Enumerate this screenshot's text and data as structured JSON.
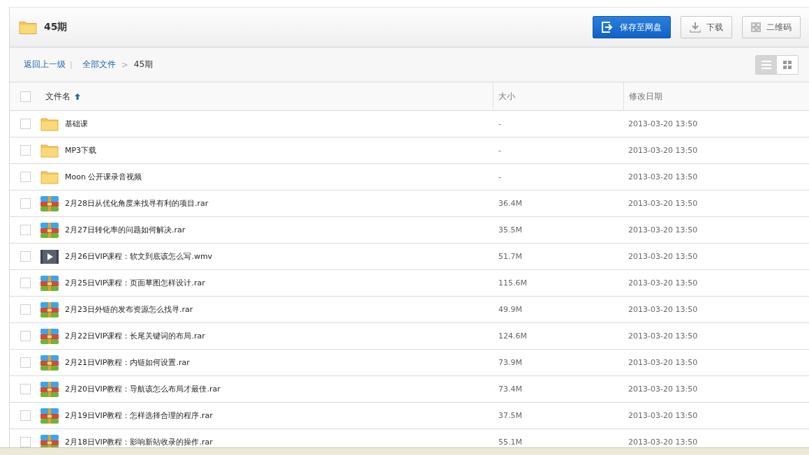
{
  "folder": {
    "title": "45期"
  },
  "actions": [
    {
      "kind": "save",
      "label": "保存至网盘"
    },
    {
      "kind": "download",
      "label": "下载"
    },
    {
      "kind": "qrcode",
      "label": "二维码"
    }
  ],
  "breadcrumb": {
    "back": "返回上一级",
    "divider": "|",
    "root": "全部文件",
    "separator": ">",
    "current": "45期"
  },
  "view_modes": [
    {
      "kind": "list",
      "selected": true
    },
    {
      "kind": "grid",
      "selected": false
    }
  ],
  "table": {
    "all_checked": false,
    "columns": [
      {
        "label": "文件名",
        "sorted_ascending": true
      },
      {
        "label": "大小"
      },
      {
        "label": "修改日期"
      }
    ],
    "rows": [
      {
        "kind": "folder",
        "name": "基础课",
        "size": "-",
        "modified": "2013-03-20 13:50",
        "checked": false
      },
      {
        "kind": "folder",
        "name": "MP3下载",
        "size": "-",
        "modified": "2013-03-20 13:50",
        "checked": false
      },
      {
        "kind": "folder",
        "name": "Moon 公开课录音视频",
        "size": "-",
        "modified": "2013-03-20 13:50",
        "checked": false
      },
      {
        "kind": "archive",
        "name": "2月28日从优化角度来找寻有利的项目.rar",
        "size": "36.4M",
        "modified": "2013-03-20 13:50",
        "checked": false
      },
      {
        "kind": "archive",
        "name": "2月27日转化率的问题如何解决.rar",
        "size": "35.5M",
        "modified": "2013-03-20 13:50",
        "checked": false
      },
      {
        "kind": "video",
        "name": "2月26日VIP课程：软文到底该怎么写.wmv",
        "size": "51.7M",
        "modified": "2013-03-20 13:50",
        "checked": false
      },
      {
        "kind": "archive",
        "name": "2月25日VIP课程：页面草图怎样设计.rar",
        "size": "115.6M",
        "modified": "2013-03-20 13:50",
        "checked": false
      },
      {
        "kind": "archive",
        "name": "2月23日外链的发布资源怎么找寻.rar",
        "size": "49.9M",
        "modified": "2013-03-20 13:50",
        "checked": false
      },
      {
        "kind": "archive",
        "name": "2月22日VIP课程：长尾关键词的布局.rar",
        "size": "124.6M",
        "modified": "2013-03-20 13:50",
        "checked": false
      },
      {
        "kind": "archive",
        "name": "2月21日VIP教程：内链如何设置.rar",
        "size": "73.9M",
        "modified": "2013-03-20 13:50",
        "checked": false
      },
      {
        "kind": "archive",
        "name": "2月20日VIP教程：导航该怎么布局才最佳.rar",
        "size": "73.4M",
        "modified": "2013-03-20 13:50",
        "checked": false
      },
      {
        "kind": "archive",
        "name": "2月19日VIP教程：怎样选择合理的程序.rar",
        "size": "37.5M",
        "modified": "2013-03-20 13:50",
        "checked": false
      },
      {
        "kind": "archive",
        "name": "2月18日VIP教程：影响新站收录的操作.rar",
        "size": "55.1M",
        "modified": "2013-03-20 13:50",
        "checked": false
      }
    ]
  }
}
